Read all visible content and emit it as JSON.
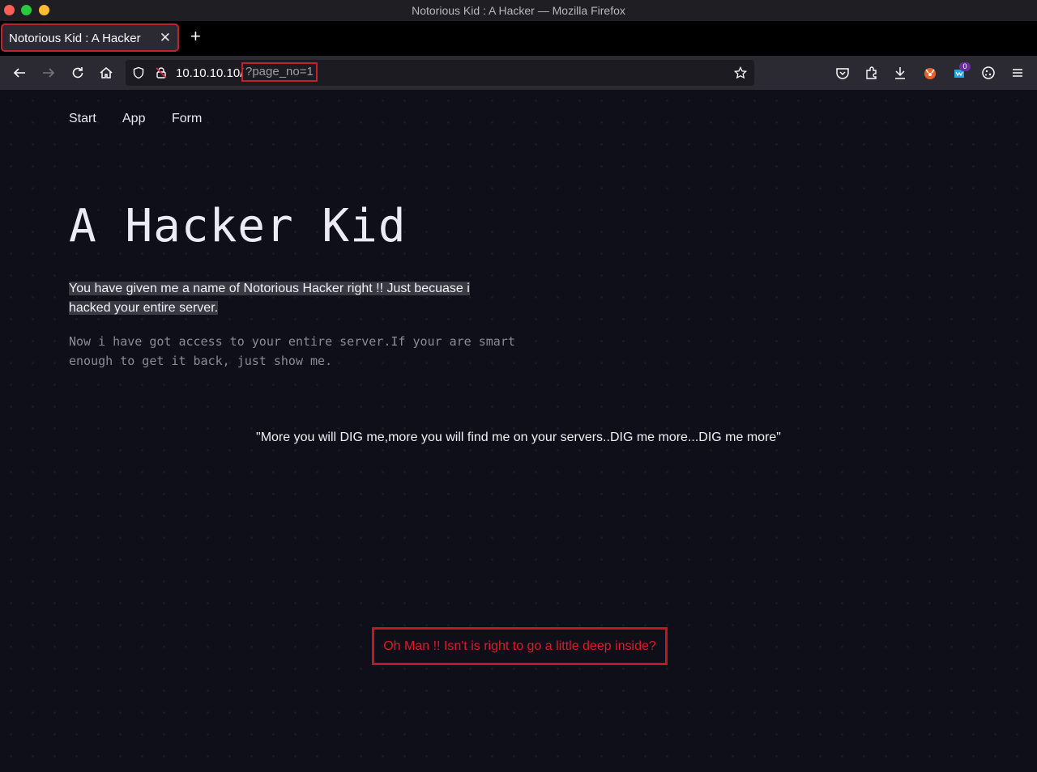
{
  "window": {
    "title": "Notorious Kid : A Hacker — Mozilla Firefox"
  },
  "tabs": [
    {
      "label": "Notorious Kid : A Hacker"
    }
  ],
  "urlbar": {
    "host": "10.10.10.10/",
    "query": "?page_no=1"
  },
  "toolbar": {
    "extension_badge": "0"
  },
  "site_nav": {
    "items": [
      "Start",
      "App",
      "Form"
    ]
  },
  "hero": {
    "title": "A Hacker Kid"
  },
  "intro": {
    "text": "You have given me a name of Notorious Hacker right !! Just becuase i hacked your entire server."
  },
  "mono_text": "Now i have got access to your entire server.If your are smart enough to get it back, just show me.",
  "quote": "\"More you will DIG me,more you will find me on your servers..DIG me more...DIG me more\"",
  "deep_message": "Oh Man !! Isn't is right to go a little deep inside?",
  "colors": {
    "accent_red": "#c01822",
    "background": "#0f0f1a"
  }
}
